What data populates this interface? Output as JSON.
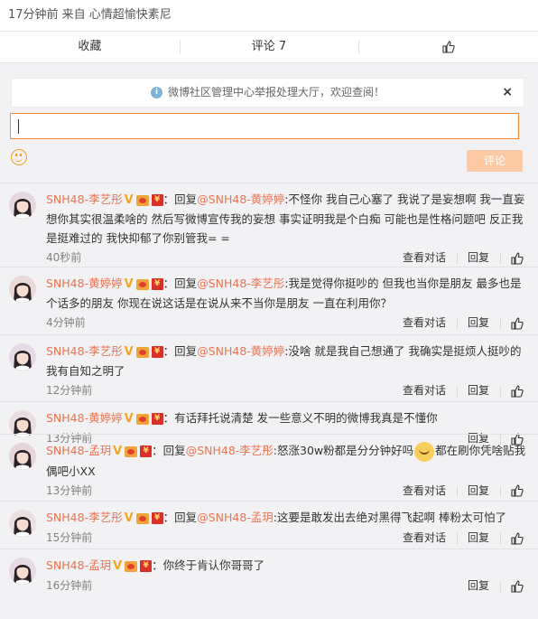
{
  "header": {
    "meta": "17分钟前 来自 心情超愉快素尼"
  },
  "tabs": {
    "collect": "收藏",
    "comment": "评论 7"
  },
  "notice": {
    "text": "微博社区管理中心举报处理大厅，欢迎查阅！",
    "close": "×"
  },
  "composer": {
    "value": "",
    "submit": "评论"
  },
  "actions": {
    "view_conversation": "查看对话",
    "reply": "回复"
  },
  "colors": {
    "accent": "#eb7350",
    "panel_bg": "#f2f2f5",
    "submit_bg": "#fbc9a4",
    "input_border": "#f08a3c"
  },
  "comments": [
    {
      "user": "SNH48-李艺彤",
      "prefix": "：回复",
      "mention": "@SNH48-黄婷婷",
      "text": ":不怪你 我自己心塞了 我说了是妄想啊 我一直妄想你其实很温柔啥的 然后写微博宣传我的妄想 事实证明我是个白痴 可能也是性格问题吧 反正我是挺难过的 我快抑郁了你别管我= =",
      "time": "40秒前",
      "has_conversation": true
    },
    {
      "user": "SNH48-黄婷婷",
      "prefix": "：回复",
      "mention": "@SNH48-李艺彤",
      "text": ":我是觉得你挺吵的 但我也当你是朋友 最多也是个话多的朋友 你现在说这话是在说从来不当你是朋友 一直在利用你？",
      "time": "4分钟前",
      "has_conversation": true
    },
    {
      "user": "SNH48-李艺彤",
      "prefix": "：回复",
      "mention": "@SNH48-黄婷婷",
      "text": ":没啥 就是我自己想通了 我确实是挺烦人挺吵的 我有自知之明了",
      "time": "12分钟前",
      "has_conversation": true
    },
    {
      "user": "SNH48-黄婷婷",
      "prefix": "",
      "mention": "",
      "text": "：有话拜托说清楚 发一些意义不明的微博我真是不懂你",
      "time": "13分钟前",
      "has_conversation": false
    },
    {
      "user": "SNH48-孟玥",
      "prefix": "：回复",
      "mention": "@SNH48-李艺彤",
      "text": ":怒涨30w粉都是分分钟好吗",
      "text2": "都在刷你凭啥贴我偶吧小XX",
      "time": "13分钟前",
      "has_conversation": true
    },
    {
      "user": "SNH48-李艺彤",
      "prefix": "：回复",
      "mention": "@SNH48-孟玥",
      "text": ":这要是敢发出去绝对黑得飞起啊 棒粉太可怕了",
      "time": "15分钟前",
      "has_conversation": true
    },
    {
      "user": "SNH48-孟玥",
      "prefix": "",
      "mention": "",
      "text": "：你终于肯认你哥哥了",
      "time": "16分钟前",
      "has_conversation": false
    }
  ]
}
